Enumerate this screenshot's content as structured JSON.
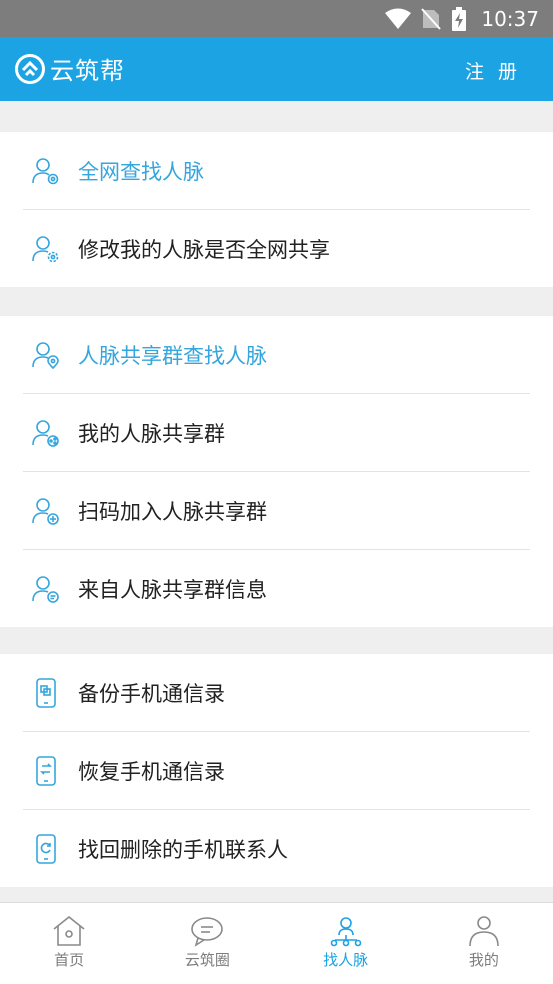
{
  "status_bar": {
    "time": "10:37"
  },
  "app_bar": {
    "brand": "云筑帮",
    "register": "注 册"
  },
  "groups": [
    {
      "items": [
        {
          "label": "全网查找人脉",
          "icon": "person-at-icon",
          "accent": true
        },
        {
          "label": "修改我的人脉是否全网共享",
          "icon": "person-gear-icon",
          "accent": false
        }
      ]
    },
    {
      "items": [
        {
          "label": "人脉共享群查找人脉",
          "icon": "person-location-icon",
          "accent": true
        },
        {
          "label": "我的人脉共享群",
          "icon": "person-share-icon",
          "accent": false
        },
        {
          "label": "扫码加入人脉共享群",
          "icon": "person-add-icon",
          "accent": false
        },
        {
          "label": "来自人脉共享群信息",
          "icon": "person-message-icon",
          "accent": false
        }
      ]
    },
    {
      "items": [
        {
          "label": "备份手机通信录",
          "icon": "phone-backup-icon",
          "accent": false
        },
        {
          "label": "恢复手机通信录",
          "icon": "phone-restore-icon",
          "accent": false
        },
        {
          "label": "找回删除的手机联系人",
          "icon": "phone-recover-icon",
          "accent": false
        }
      ]
    }
  ],
  "tabs": [
    {
      "label": "首页",
      "icon": "home-icon",
      "active": false
    },
    {
      "label": "云筑圈",
      "icon": "chat-bubble-icon",
      "active": false
    },
    {
      "label": "找人脉",
      "icon": "network-icon",
      "active": true
    },
    {
      "label": "我的",
      "icon": "user-icon",
      "active": false
    }
  ],
  "colors": {
    "brand": "#1ba3e4",
    "accent_text": "#35a6dd",
    "background": "#efefef"
  }
}
